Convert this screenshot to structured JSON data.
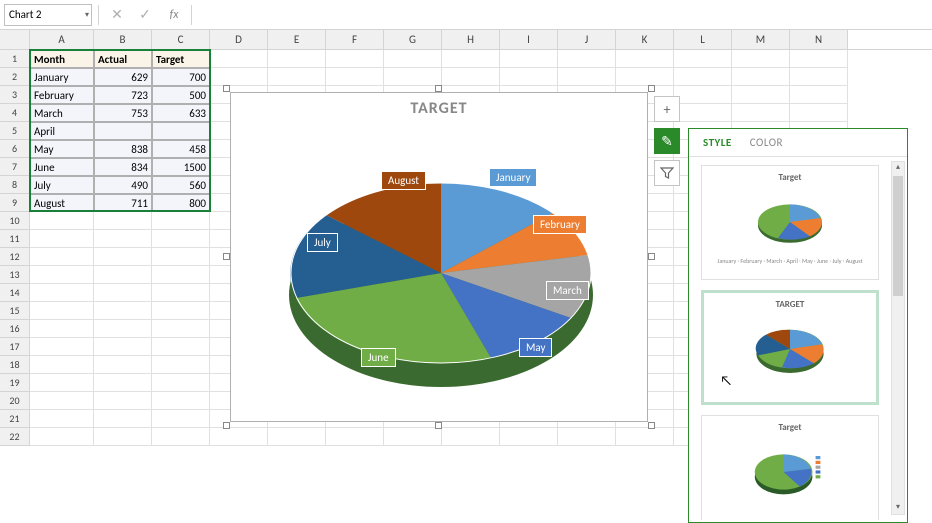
{
  "name_box": "Chart 2",
  "formula_bar": {
    "cancel": "✕",
    "confirm": "✓",
    "fx": "fx"
  },
  "columns": [
    "A",
    "B",
    "C",
    "D",
    "E",
    "F",
    "G",
    "H",
    "I",
    "J",
    "K",
    "L",
    "M",
    "N"
  ],
  "row_count": 22,
  "table": {
    "headers": [
      "Month",
      "Actual",
      "Target"
    ],
    "rows": [
      {
        "month": "January",
        "actual": 629,
        "target": 700
      },
      {
        "month": "February",
        "actual": 723,
        "target": 500
      },
      {
        "month": "March",
        "actual": 753,
        "target": 633
      },
      {
        "month": "April",
        "actual": "",
        "target": ""
      },
      {
        "month": "May",
        "actual": 838,
        "target": 458
      },
      {
        "month": "June",
        "actual": 834,
        "target": 1500
      },
      {
        "month": "July",
        "actual": 490,
        "target": 560
      },
      {
        "month": "August",
        "actual": 711,
        "target": 800
      }
    ]
  },
  "chart_title": "TARGET",
  "slice_labels": [
    "January",
    "February",
    "March",
    "May",
    "June",
    "July",
    "August"
  ],
  "chart_actions": {
    "add": "+",
    "brush": "✎",
    "filter": "▾"
  },
  "gallery": {
    "tabs": [
      "STYLE",
      "COLOR"
    ],
    "active_tab": "STYLE",
    "thumbs": [
      {
        "title": "Target"
      },
      {
        "title": "TARGET"
      },
      {
        "title": "Target"
      }
    ]
  },
  "chart_data": {
    "type": "pie",
    "title": "TARGET",
    "categories": [
      "January",
      "February",
      "March",
      "April",
      "May",
      "June",
      "July",
      "August"
    ],
    "values": [
      700,
      500,
      633,
      0,
      458,
      1500,
      560,
      800
    ],
    "series_name": "Target",
    "colors": {
      "January": "#5b9bd5",
      "February": "#ed7d31",
      "March": "#a5a5a5",
      "April": "#ffc000",
      "May": "#4472c4",
      "June": "#70ad47",
      "July": "#255e91",
      "August": "#9e480e"
    }
  }
}
